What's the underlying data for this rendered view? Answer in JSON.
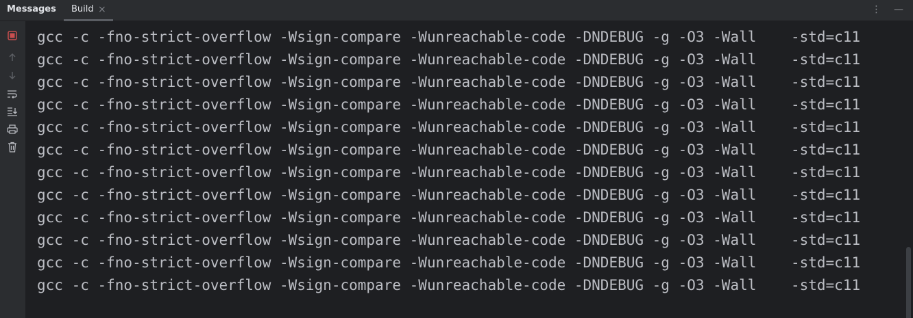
{
  "tabs": {
    "messages_label": "Messages",
    "build_label": "Build",
    "build_close": "×",
    "more_icon": "⋮",
    "minimize_icon": "—"
  },
  "toolbar": {
    "icons": [
      "stop-icon",
      "up-arrow-icon",
      "down-arrow-icon",
      "soft-wrap-icon",
      "scroll-to-end-icon",
      "print-icon",
      "trash-icon"
    ],
    "stop_color": "#c94f4f"
  },
  "output": {
    "lines": [
      "gcc -c -fno-strict-overflow -Wsign-compare -Wunreachable-code -DNDEBUG -g -O3 -Wall    -std=c11",
      "gcc -c -fno-strict-overflow -Wsign-compare -Wunreachable-code -DNDEBUG -g -O3 -Wall    -std=c11",
      "gcc -c -fno-strict-overflow -Wsign-compare -Wunreachable-code -DNDEBUG -g -O3 -Wall    -std=c11",
      "gcc -c -fno-strict-overflow -Wsign-compare -Wunreachable-code -DNDEBUG -g -O3 -Wall    -std=c11",
      "gcc -c -fno-strict-overflow -Wsign-compare -Wunreachable-code -DNDEBUG -g -O3 -Wall    -std=c11",
      "gcc -c -fno-strict-overflow -Wsign-compare -Wunreachable-code -DNDEBUG -g -O3 -Wall    -std=c11",
      "gcc -c -fno-strict-overflow -Wsign-compare -Wunreachable-code -DNDEBUG -g -O3 -Wall    -std=c11",
      "gcc -c -fno-strict-overflow -Wsign-compare -Wunreachable-code -DNDEBUG -g -O3 -Wall    -std=c11",
      "gcc -c -fno-strict-overflow -Wsign-compare -Wunreachable-code -DNDEBUG -g -O3 -Wall    -std=c11",
      "gcc -c -fno-strict-overflow -Wsign-compare -Wunreachable-code -DNDEBUG -g -O3 -Wall    -std=c11",
      "gcc -c -fno-strict-overflow -Wsign-compare -Wunreachable-code -DNDEBUG -g -O3 -Wall    -std=c11",
      "gcc -c -fno-strict-overflow -Wsign-compare -Wunreachable-code -DNDEBUG -g -O3 -Wall    -std=c11"
    ]
  }
}
